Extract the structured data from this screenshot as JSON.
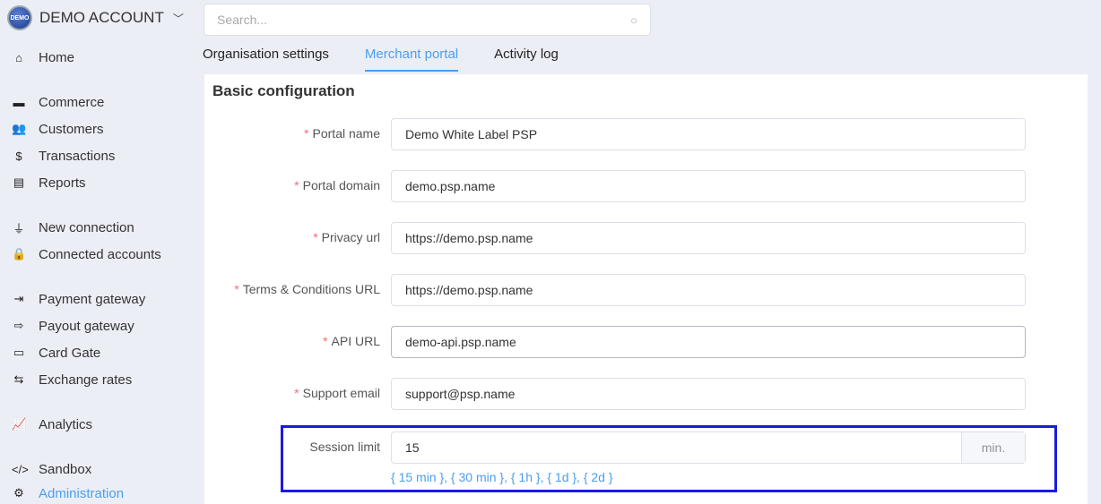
{
  "account": {
    "logo_text": "DEMO",
    "name": "DEMO ACCOUNT"
  },
  "sidebar": {
    "items": [
      {
        "label": "Home",
        "icon": "home-icon",
        "glyph": "⌂"
      },
      {
        "label": "Commerce",
        "icon": "store-icon",
        "glyph": "▬"
      },
      {
        "label": "Customers",
        "icon": "users-icon",
        "glyph": "👥"
      },
      {
        "label": "Transactions",
        "icon": "dollar-icon",
        "glyph": "$"
      },
      {
        "label": "Reports",
        "icon": "file-download-icon",
        "glyph": "▤"
      },
      {
        "label": "New connection",
        "icon": "plug-icon",
        "glyph": "⏚"
      },
      {
        "label": "Connected accounts",
        "icon": "lock-icon",
        "glyph": "🔒"
      },
      {
        "label": "Payment gateway",
        "icon": "sign-in-icon",
        "glyph": "⇥"
      },
      {
        "label": "Payout gateway",
        "icon": "sign-out-icon",
        "glyph": "⇨"
      },
      {
        "label": "Card Gate",
        "icon": "credit-card-icon",
        "glyph": "▭"
      },
      {
        "label": "Exchange rates",
        "icon": "exchange-icon",
        "glyph": "⇆"
      },
      {
        "label": "Analytics",
        "icon": "chart-line-icon",
        "glyph": "📈"
      },
      {
        "label": "Sandbox",
        "icon": "code-icon",
        "glyph": "</>"
      },
      {
        "label": "Administration",
        "icon": "gear-icon",
        "glyph": "⚙"
      }
    ]
  },
  "search": {
    "placeholder": "Search..."
  },
  "tabs": [
    {
      "label": "Organisation settings"
    },
    {
      "label": "Merchant portal",
      "active": true
    },
    {
      "label": "Activity log"
    }
  ],
  "section_title": "Basic configuration",
  "fields": [
    {
      "label": "Portal name",
      "required": true,
      "value": "Demo White Label PSP"
    },
    {
      "label": "Portal domain",
      "required": true,
      "value": "demo.psp.name"
    },
    {
      "label": "Privacy url",
      "required": true,
      "value": "https://demo.psp.name"
    },
    {
      "label": "Terms & Conditions URL",
      "required": true,
      "value": "https://demo.psp.name"
    },
    {
      "label": "API URL",
      "required": true,
      "value": "demo-api.psp.name"
    },
    {
      "label": "Support email",
      "required": true,
      "value": "support@psp.name"
    }
  ],
  "session": {
    "label": "Session limit",
    "value": "15",
    "unit": "min.",
    "presets": "{ 15 min }, { 30 min }, { 1h }, { 1d }, { 2d }"
  },
  "colors": {
    "accent": "#4a9ef0",
    "required": "#f56c6c",
    "highlight": "#1a1ae0"
  }
}
